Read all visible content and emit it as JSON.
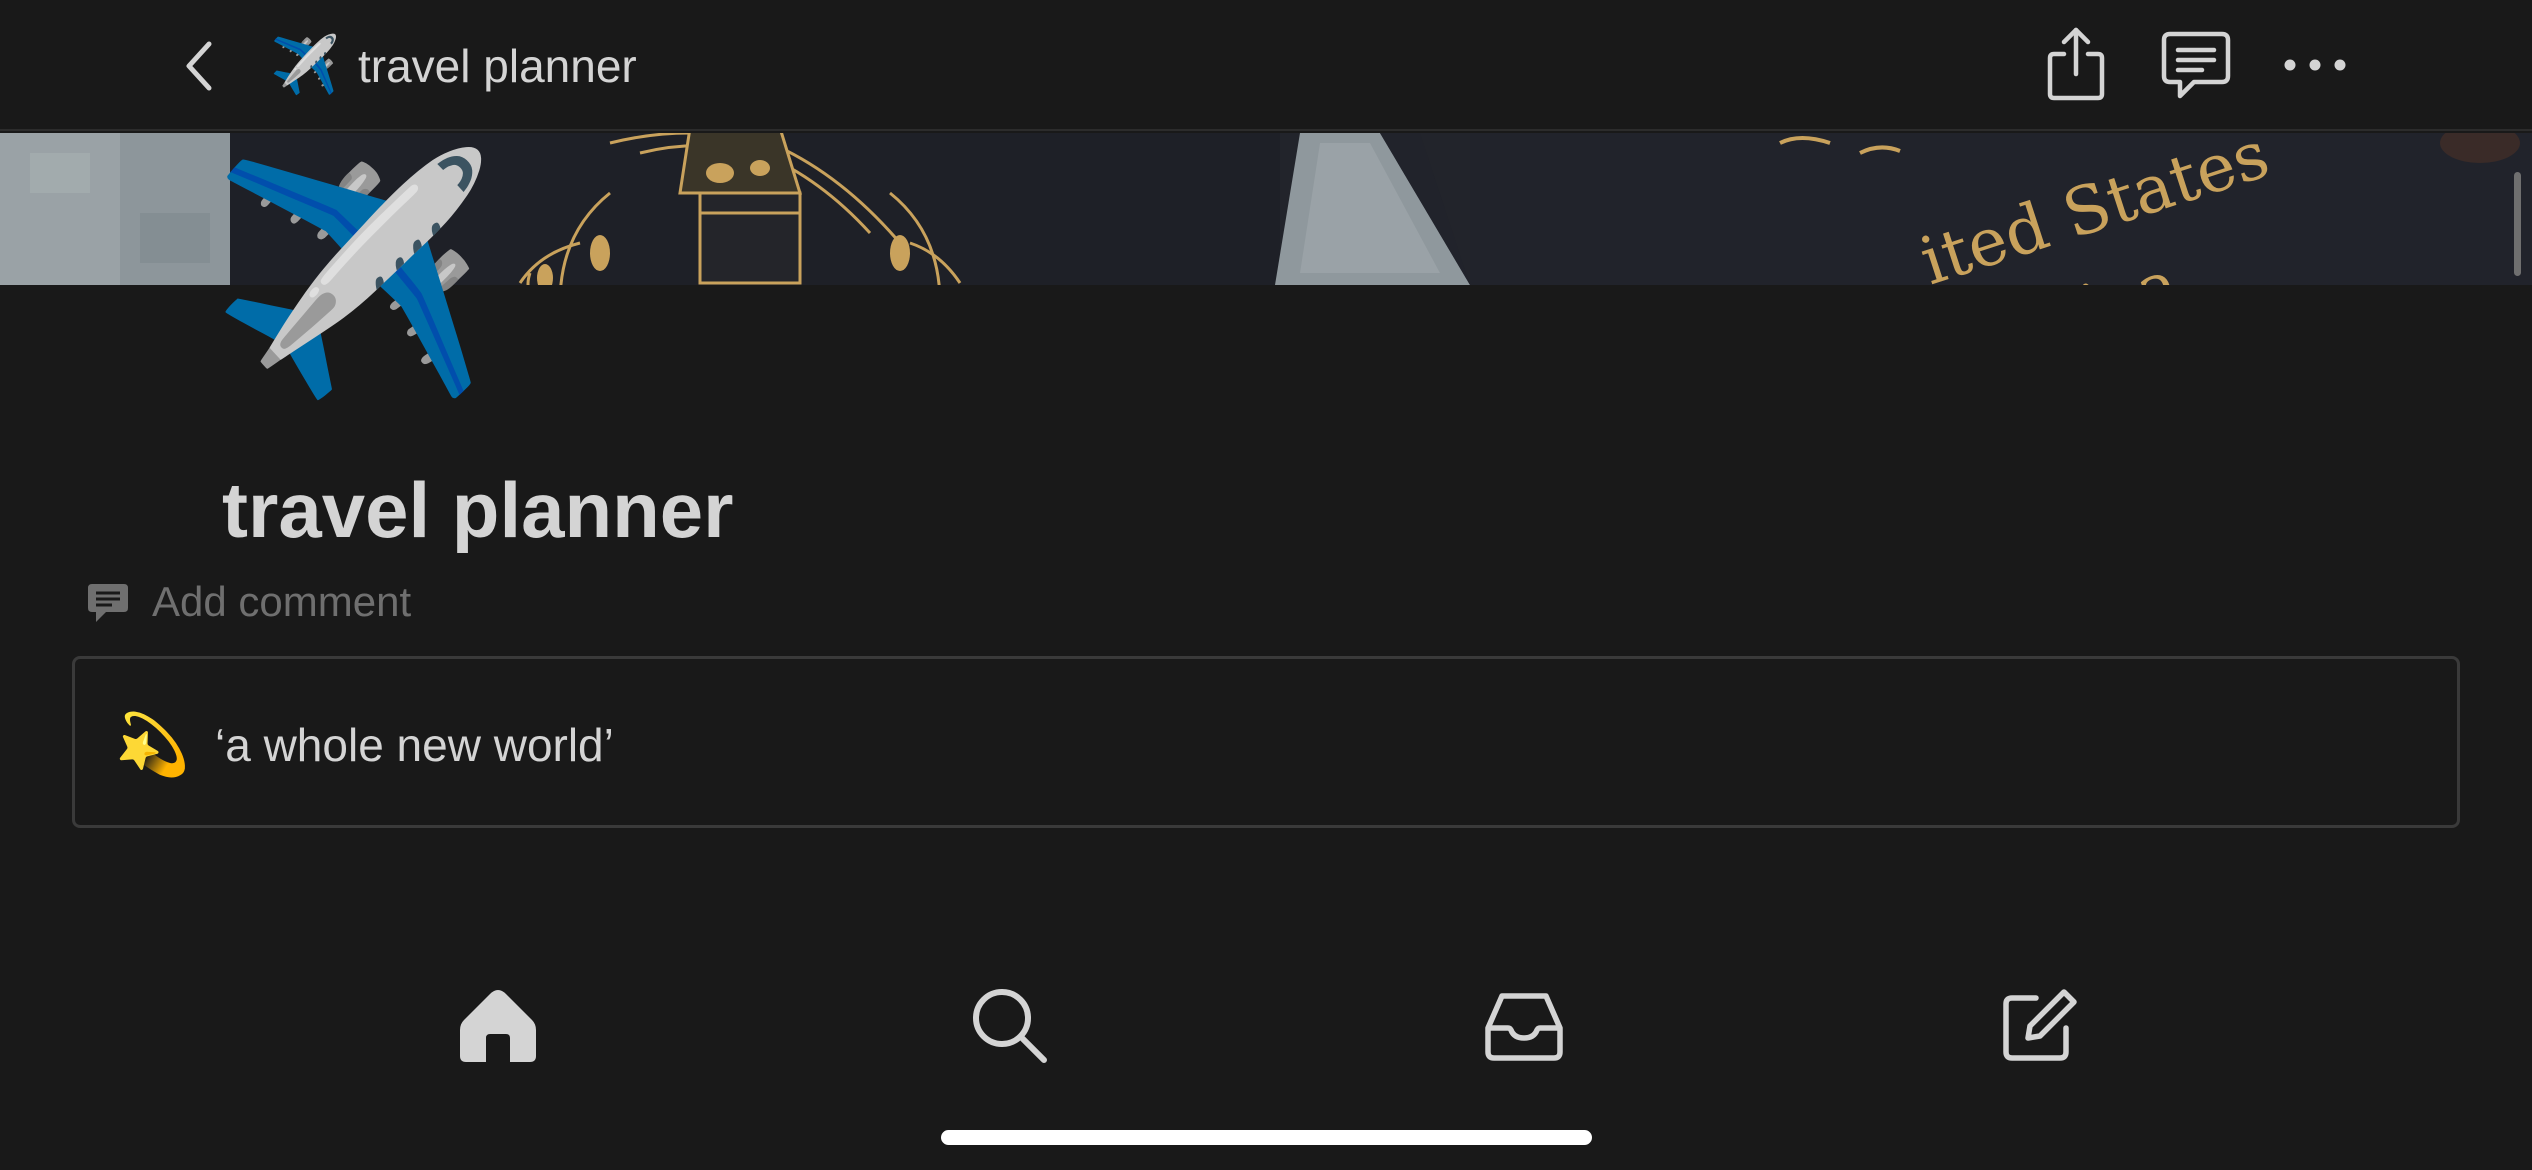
{
  "nav": {
    "back_icon": "chevron-left-icon",
    "emoji": "✈️",
    "title": "travel planner",
    "actions": [
      {
        "name": "share",
        "icon": "share-icon"
      },
      {
        "name": "comments",
        "icon": "comment-icon"
      },
      {
        "name": "more",
        "icon": "ellipsis-icon"
      }
    ]
  },
  "cover": {
    "description_text": "ited States",
    "description_text_2": "ica"
  },
  "page": {
    "icon": "✈️",
    "title": "travel planner",
    "add_comment_label": "Add comment",
    "callout": {
      "emoji": "💫",
      "text": "‘a whole new world’"
    }
  },
  "tabbar": {
    "tabs": [
      {
        "name": "home",
        "icon": "home-icon",
        "active": true
      },
      {
        "name": "search",
        "icon": "search-icon",
        "active": false
      },
      {
        "name": "inbox",
        "icon": "inbox-icon",
        "active": false
      },
      {
        "name": "new-page",
        "icon": "compose-icon",
        "active": false
      }
    ]
  },
  "colors": {
    "background": "#191919",
    "text": "#d4d4d4",
    "muted": "#6f6f6f",
    "border": "#3a3a3a",
    "cover_gold": "#c9a25c"
  }
}
